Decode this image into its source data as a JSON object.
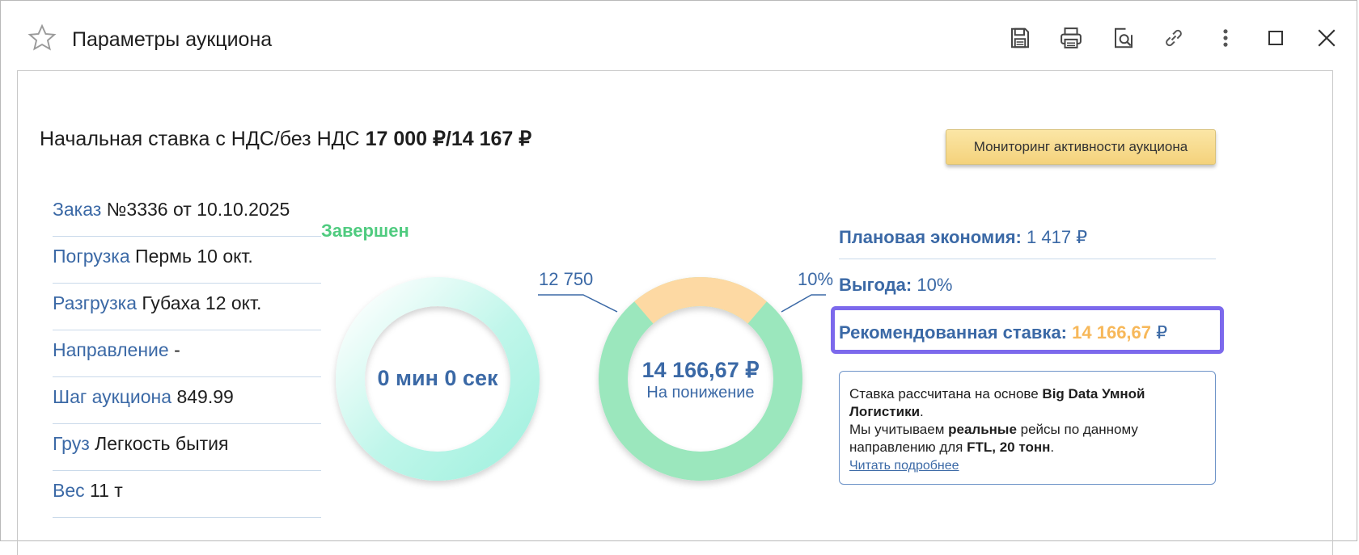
{
  "window": {
    "title": "Параметры аукциона"
  },
  "toolbar": {
    "icons": [
      "save-icon",
      "print-icon",
      "preview-icon",
      "link-icon",
      "more-icon",
      "maximize-icon",
      "close-icon"
    ]
  },
  "start_bid": {
    "prefix": "Начальная ставка с НДС/без НДС ",
    "value": "17 000 ₽/14 167 ₽"
  },
  "monitor_button": {
    "label": "Мониторинг активности аукциона"
  },
  "order_info": [
    {
      "label": "Заказ",
      "value": " №3336 от 10.10.2025"
    },
    {
      "label": "Погрузка",
      "value": " Пермь 10 окт."
    },
    {
      "label": "Разгрузка",
      "value": " Губаха 12 окт."
    },
    {
      "label": "Направление",
      "value": " -"
    },
    {
      "label": "Шаг аукциона",
      "value": " 849.99"
    },
    {
      "label": "Груз",
      "value": " Легкость бытия"
    },
    {
      "label": "Вес",
      "value": " 11 т"
    }
  ],
  "status": "Завершен",
  "timer": {
    "text": "0 мин 0 сек"
  },
  "bid_ring": {
    "left_label": "12 750",
    "right_label": "10%",
    "center_value": "14 166,67 ₽",
    "center_sub": "На понижение",
    "colors": {
      "green": "#9be7bd",
      "orange": "#fdd9a3",
      "teal": "#aef3e6"
    }
  },
  "summary": {
    "plan_saving_label": "Плановая экономия:",
    "plan_saving_value": " 1 417 ₽",
    "benefit_label": "Выгода:",
    "benefit_value": " 10%",
    "recommended_label": "Рекомендованная ставка:",
    "recommended_value": "14 166,67",
    "recommended_currency": " ₽"
  },
  "info_box": {
    "line1_a": "Ставка рассчитана на основе ",
    "line1_b": "Big Data Умной Логистики",
    "line1_c": ".",
    "line2_a": "Мы учитываем ",
    "line2_b": "реальные",
    "line2_c": " рейсы по данному направлению для ",
    "line2_d": "FTL, 20 тонн",
    "line2_e": ".",
    "link": "Читать подробнее"
  },
  "colors": {
    "accent_blue": "#3b69a6",
    "status_green": "#4fcb7f",
    "orange_value": "#f7b85a",
    "highlight": "#7c69ec"
  }
}
